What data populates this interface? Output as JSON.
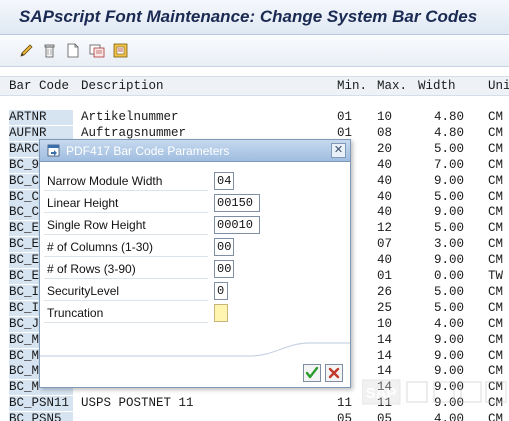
{
  "window": {
    "title": "SAPscript Font Maintenance: Change System Bar Codes"
  },
  "toolbar": {
    "icons": [
      "pencil-icon",
      "trash-icon",
      "new-document-icon",
      "print-preview-icon",
      "transport-icon"
    ]
  },
  "list": {
    "headers": {
      "code": "Bar Code",
      "description": "Description",
      "min": "Min.",
      "max": "Max.",
      "width": "Width",
      "unit": "Uni"
    },
    "rows": [
      {
        "code": "ARTNR",
        "description": "Artikelnummer",
        "min": "01",
        "max": "10",
        "width": "4.80",
        "unit": "CM"
      },
      {
        "code": "AUFNR",
        "description": "Auftragsnummer",
        "min": "01",
        "max": "08",
        "width": "4.80",
        "unit": "CM"
      },
      {
        "code": "BARC",
        "description": "",
        "min": "",
        "max": "20",
        "width": "5.00",
        "unit": "CM"
      },
      {
        "code": "BC_9",
        "description": "",
        "min": "",
        "max": "40",
        "width": "7.00",
        "unit": "CM"
      },
      {
        "code": "BC_C",
        "description": "",
        "min": "",
        "max": "40",
        "width": "9.00",
        "unit": "CM"
      },
      {
        "code": "BC_C",
        "description": "",
        "min": "",
        "max": "40",
        "width": "5.00",
        "unit": "CM"
      },
      {
        "code": "BC_C",
        "description": "",
        "min": "",
        "max": "40",
        "width": "9.00",
        "unit": "CM"
      },
      {
        "code": "BC_E",
        "description": "",
        "min": "",
        "max": "12",
        "width": "5.00",
        "unit": "CM"
      },
      {
        "code": "BC_E",
        "description": "",
        "min": "",
        "max": "07",
        "width": "3.00",
        "unit": "CM"
      },
      {
        "code": "BC_E",
        "description": "",
        "min": "",
        "max": "40",
        "width": "9.00",
        "unit": "CM"
      },
      {
        "code": "BC_E",
        "description": "",
        "min": "",
        "max": "01",
        "width": "0.00",
        "unit": "TW"
      },
      {
        "code": "BC_I",
        "description": "",
        "min": "",
        "max": "26",
        "width": "5.00",
        "unit": "CM"
      },
      {
        "code": "BC_I",
        "description": "",
        "min": "",
        "max": "25",
        "width": "5.00",
        "unit": "CM"
      },
      {
        "code": "BC_J",
        "description": "",
        "min": "",
        "max": "10",
        "width": "4.00",
        "unit": "CM"
      },
      {
        "code": "BC_M",
        "description": "",
        "min": "",
        "max": "14",
        "width": "9.00",
        "unit": "CM"
      },
      {
        "code": "BC_M",
        "description": "",
        "min": "",
        "max": "14",
        "width": "9.00",
        "unit": "CM"
      },
      {
        "code": "BC_M",
        "description": "",
        "min": "",
        "max": "14",
        "width": "9.00",
        "unit": "CM"
      },
      {
        "code": "BC_M",
        "description": "",
        "min": "",
        "max": "14",
        "width": "9.00",
        "unit": "CM"
      },
      {
        "code": "BC_PSN11",
        "description": "USPS POSTNET 11",
        "min": "11",
        "max": "11",
        "width": "9.00",
        "unit": "CM"
      },
      {
        "code": "BC_PSN5",
        "description": "",
        "min": "05",
        "max": "05",
        "width": "4.00",
        "unit": "CM"
      }
    ]
  },
  "dialog": {
    "title": "PDF417 Bar Code Parameters",
    "fields": [
      {
        "label": "Narrow Module Width",
        "value": "04"
      },
      {
        "label": "Linear Height",
        "value": "00150"
      },
      {
        "label": "Single Row Height",
        "value": "00010"
      },
      {
        "label": "# of Columns (1-30)",
        "value": "00"
      },
      {
        "label": "# of Rows (3-90)",
        "value": "00"
      },
      {
        "label": "SecurityLevel",
        "value": "0"
      },
      {
        "label": "Truncation",
        "value": ""
      }
    ]
  },
  "watermark": {
    "text": "SAP"
  },
  "colors": {
    "accent": "#9fbde0",
    "title_text": "#1b2a52",
    "confirm": "#2e9a2e",
    "cancel": "#c0392b"
  }
}
